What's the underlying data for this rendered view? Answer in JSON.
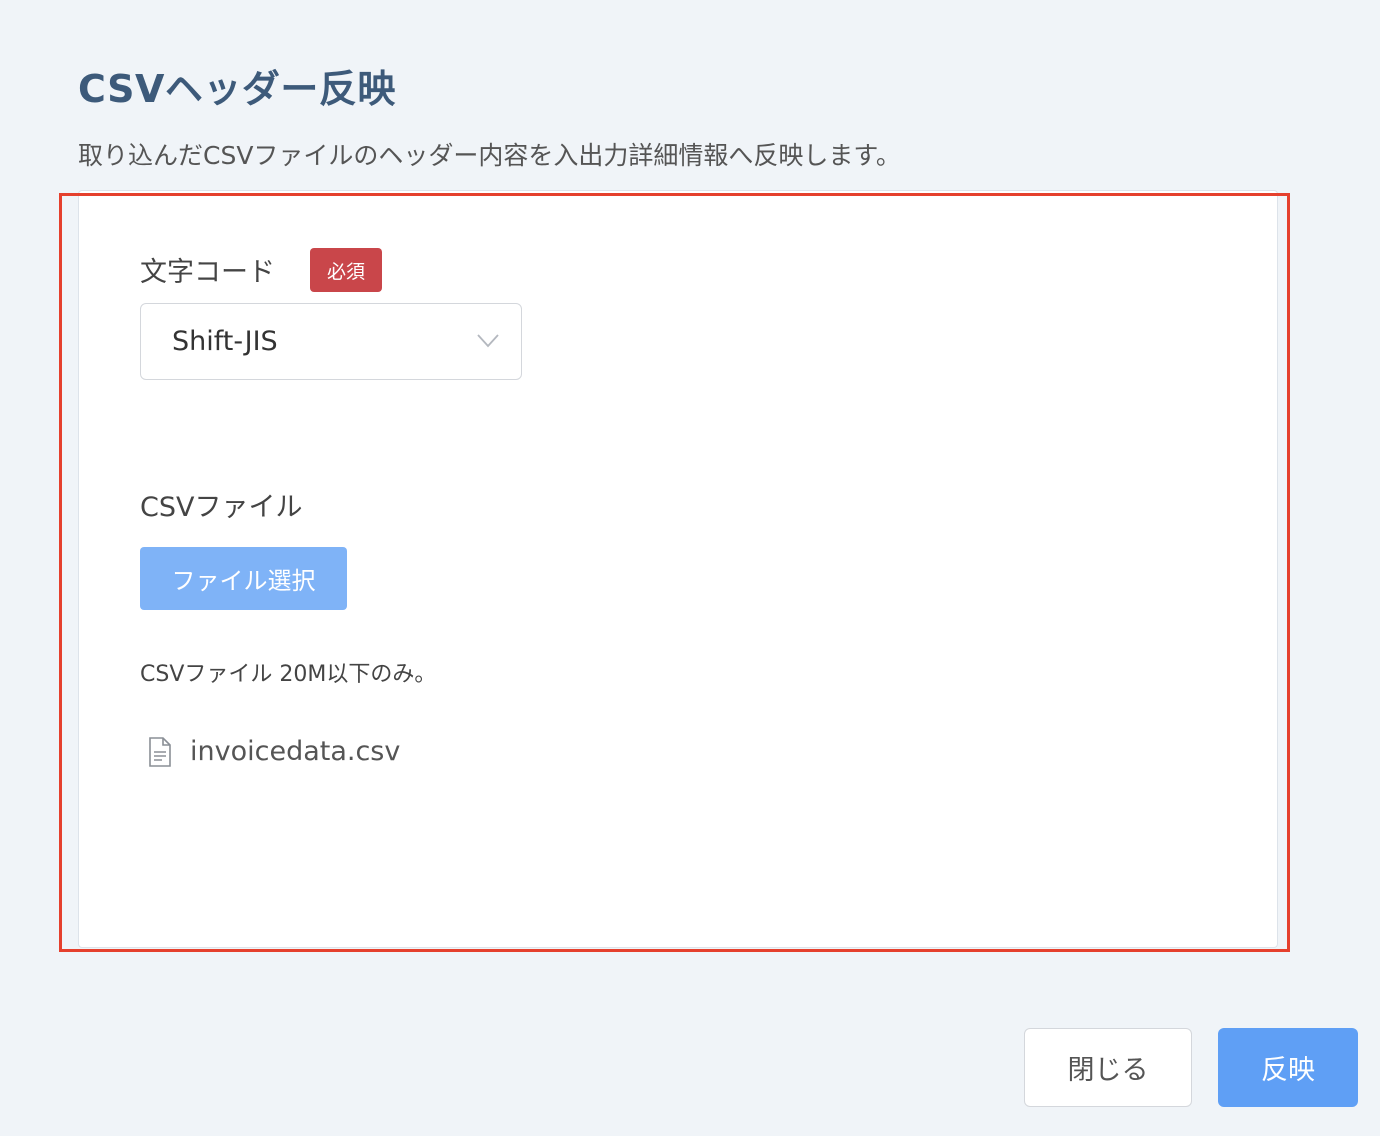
{
  "header": {
    "title": "CSVヘッダー反映",
    "description": "取り込んだCSVファイルのヘッダー内容を入出力詳細情報へ反映します。"
  },
  "form": {
    "encoding": {
      "label": "文字コード",
      "required_badge": "必須",
      "selected": "Shift-JIS",
      "chevron_icon": "chevron-down-icon"
    },
    "csv_file": {
      "label": "CSVファイル",
      "select_button": "ファイル選択",
      "hint": "CSVファイル 20M以下のみ。",
      "file_icon": "document-icon",
      "file_name": "invoicedata.csv"
    }
  },
  "footer": {
    "close_label": "閉じる",
    "apply_label": "反映"
  },
  "colors": {
    "title": "#3d5a7a",
    "required_badge": "#c9464a",
    "file_button": "#7fb3f7",
    "apply_button": "#5f9ff5",
    "highlight_frame": "#e5402d"
  }
}
